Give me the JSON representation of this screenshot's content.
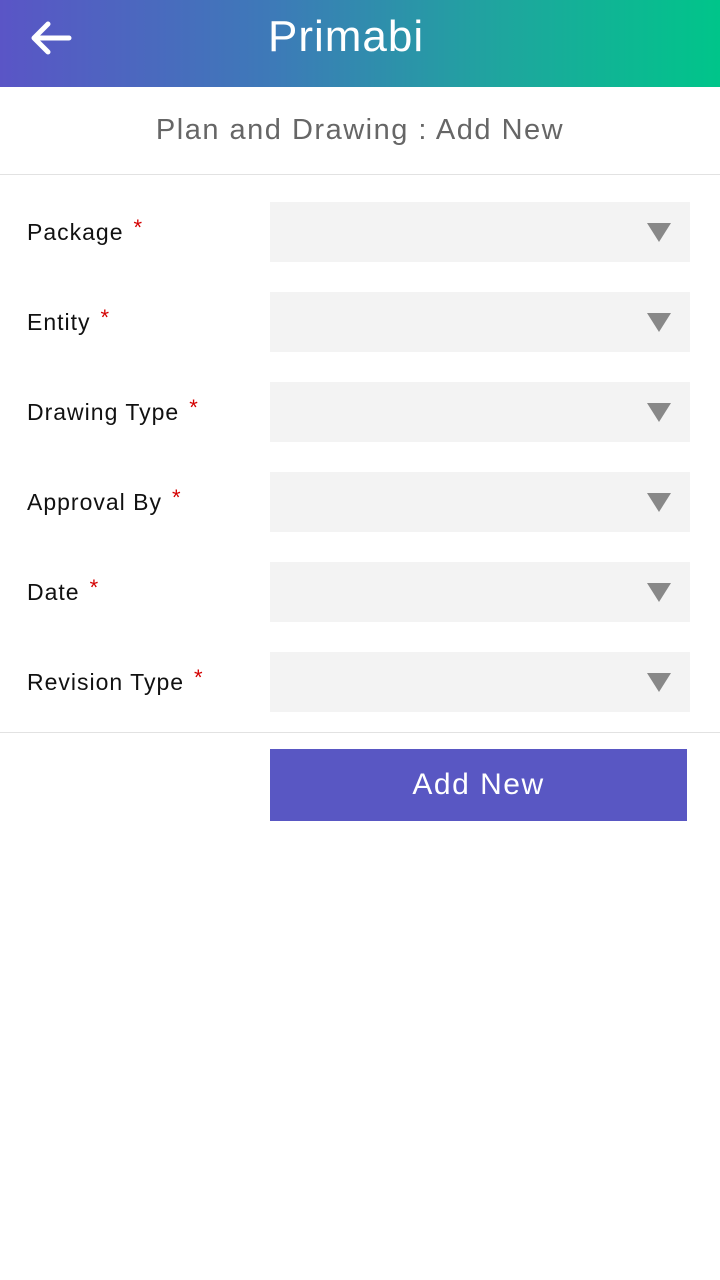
{
  "header": {
    "back_icon": "arrow-left-icon",
    "logo_text": "Primabi"
  },
  "page": {
    "title": "Plan and Drawing : Add New"
  },
  "form": {
    "required_marker": "*",
    "dropdown_icon": "triangle-down-icon",
    "fields": [
      {
        "label": "Package",
        "value": ""
      },
      {
        "label": "Entity",
        "value": ""
      },
      {
        "label": "Drawing Type",
        "value": ""
      },
      {
        "label": "Approval By",
        "value": ""
      },
      {
        "label": "Date",
        "value": ""
      },
      {
        "label": "Revision Type",
        "value": ""
      }
    ],
    "submit_label": "Add New"
  },
  "colors": {
    "header_gradient_start": "#5a55c6",
    "header_gradient_end": "#00c58a",
    "button_bg": "#5957c3",
    "required": "#d40000",
    "select_bg": "#f3f3f3"
  }
}
